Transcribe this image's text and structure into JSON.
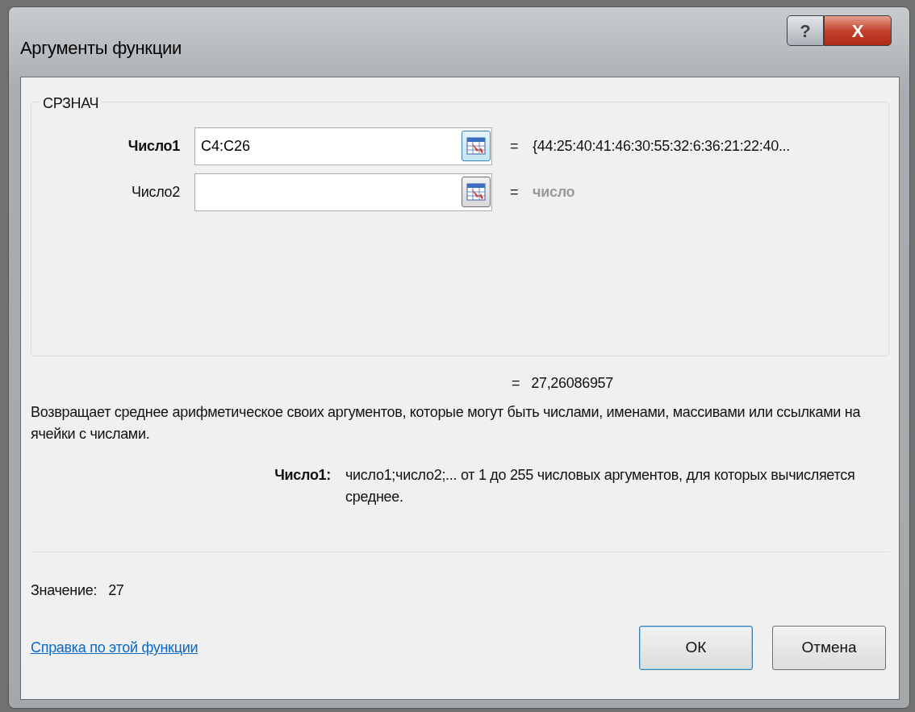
{
  "window": {
    "title": "Аргументы функции",
    "controls": [
      {
        "kind": "help",
        "label": "?"
      },
      {
        "kind": "close",
        "label": "X"
      }
    ]
  },
  "function": {
    "name": "СРЗНАЧ"
  },
  "arguments": [
    {
      "label": "Число1",
      "value": "C4:C26",
      "focused": true,
      "equals": "=",
      "result": "{44:25:40:41:46:30:55:32:6:36:21:22:40...",
      "kind": "value"
    },
    {
      "label": "Число2",
      "focused": false,
      "equals": "=",
      "result": "число",
      "kind": "hint"
    }
  ],
  "formula_result": {
    "equals": "=",
    "value": "27,26086957"
  },
  "description": "Возвращает среднее арифметическое своих аргументов, которые могут быть числами, именами, массивами или ссылками на ячейки с числами.",
  "argument_help": {
    "label": "Число1:",
    "text": "число1;число2;... от 1 до 255 числовых аргументов, для которых вычисляется среднее."
  },
  "value": {
    "label": "Значение:",
    "value": "27"
  },
  "help_link": "Справка по этой функции",
  "buttons": [
    {
      "label": "ОК",
      "default": true
    },
    {
      "label": "Отмена",
      "default": false
    }
  ]
}
